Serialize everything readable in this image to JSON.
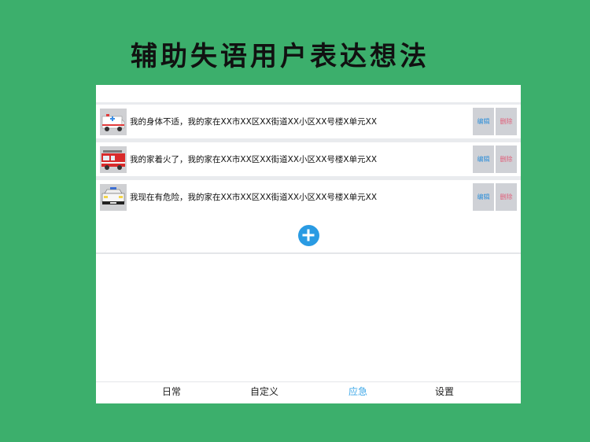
{
  "headline": "辅助失语用户表达想法",
  "rows": [
    {
      "text": "我的身体不适，我的家在XX市XX区XX街道XX小区XX号楼X单元XX",
      "icon": "ambulance-icon",
      "edit": "编辑",
      "delete": "删除"
    },
    {
      "text": "我的家着火了，我的家在XX市XX区XX街道XX小区XX号楼X单元XX",
      "icon": "fire-truck-icon",
      "edit": "编辑",
      "delete": "删除"
    },
    {
      "text": "我现在有危险，我的家在XX市XX区XX街道XX小区XX号楼X单元XX",
      "icon": "police-car-icon",
      "edit": "编辑",
      "delete": "删除"
    }
  ],
  "add_icon": "plus-circle-icon",
  "tabs": [
    {
      "label": "日常"
    },
    {
      "label": "自定义"
    },
    {
      "label": "应急"
    },
    {
      "label": "设置"
    }
  ],
  "active_tab": "应急",
  "colors": {
    "background": "#3caf6c",
    "accent": "#2a9be3",
    "delete": "#e0607a"
  }
}
